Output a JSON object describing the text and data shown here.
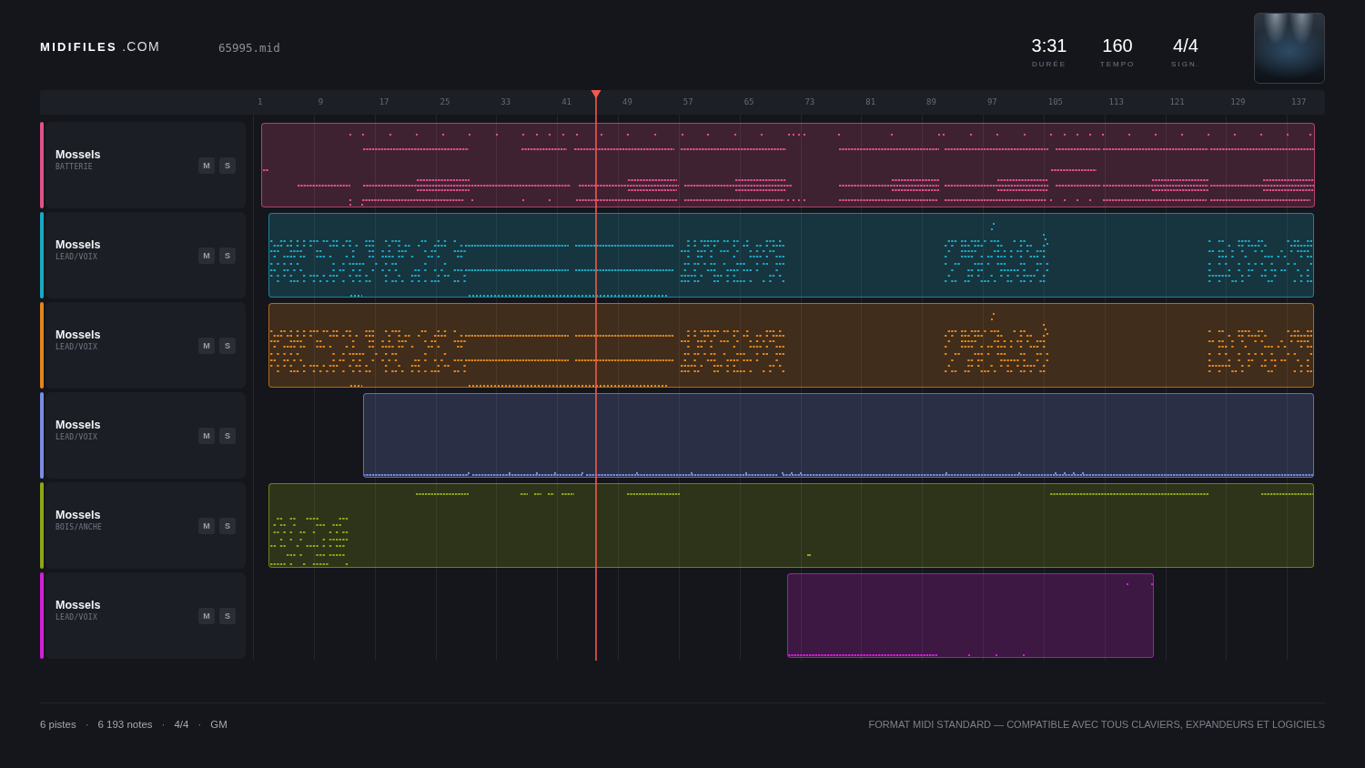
{
  "header": {
    "logo": "**MIDIFILES** .COM",
    "file_name": "65995.mid",
    "stats": [
      {
        "value": "3:31",
        "label": "DURÉE"
      },
      {
        "value": "160",
        "label": "TEMPO"
      },
      {
        "value": "4/4",
        "label": "SIGN."
      }
    ]
  },
  "ruler": {
    "labels": [
      "1",
      "9",
      "17",
      "25",
      "33",
      "41",
      "49",
      "57",
      "65",
      "73",
      "81",
      "89",
      "97",
      "105",
      "113",
      "121",
      "129",
      "137"
    ]
  },
  "playback": {
    "level": 0.32
  },
  "tracks": [
    {
      "name": "Mossels",
      "instrument": "BATTERIE",
      "color": "#e0508a",
      "mute_label": "M",
      "solo_label": "S"
    },
    {
      "name": "Mossels",
      "instrument": "LEAD/VOIX",
      "color": "#1aa9c4",
      "mute_label": "M",
      "solo_label": "S"
    },
    {
      "name": "Mossels",
      "instrument": "LEAD/VOIX",
      "color": "#e2861c",
      "mute_label": "M",
      "solo_label": "S"
    },
    {
      "name": "Mossels",
      "instrument": "LEAD/VOIX",
      "color": "#7b8ce2",
      "mute_label": "M",
      "solo_label": "S"
    },
    {
      "name": "Mossels",
      "instrument": "BOIS/ANCHE",
      "color": "#8fa516",
      "mute_label": "M",
      "solo_label": "S"
    },
    {
      "name": "Mossels",
      "instrument": "LEAD/VOIX",
      "color": "#d41fd8",
      "mute_label": "M",
      "solo_label": "S"
    }
  ],
  "footer": {
    "items": [
      {
        "kind": "stat",
        "text": "6 pistes"
      },
      {
        "kind": "separator",
        "text": "·"
      },
      {
        "kind": "stat",
        "text": "6 193 notes"
      },
      {
        "kind": "separator",
        "text": "·"
      },
      {
        "kind": "stat",
        "text": "4/4"
      },
      {
        "kind": "separator",
        "text": "·"
      },
      {
        "kind": "stat",
        "text": "GM"
      }
    ],
    "note": "FORMAT MIDI STANDARD — COMPATIBLE AVEC TOUS CLAVIERS, EXPANDEURS ET LOGICIELS"
  }
}
